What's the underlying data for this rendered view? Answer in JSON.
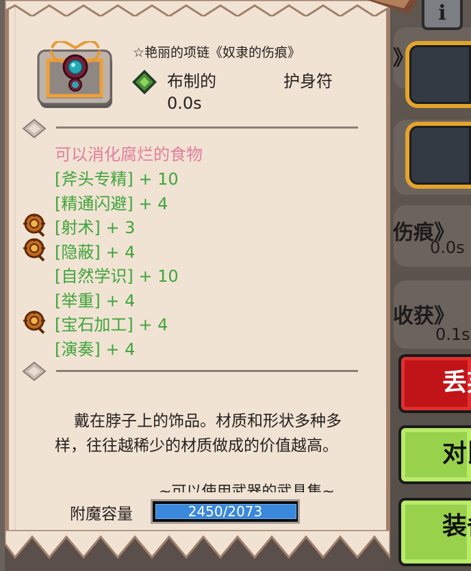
{
  "info_button": {
    "label": "i"
  },
  "item": {
    "name": "☆艳丽的项链《奴隶的伤痕》",
    "type": "布制的",
    "category": "护身符",
    "time": "0.0s"
  },
  "effects": {
    "special": "可以消化腐烂的食物",
    "stats": [
      {
        "label": "[斧头专精] + 10",
        "has_icon": false
      },
      {
        "label": "[精通闪避] + 4",
        "has_icon": false
      },
      {
        "label": "[射术] + 3",
        "has_icon": true
      },
      {
        "label": "[隐蔽] + 4",
        "has_icon": true
      },
      {
        "label": "[自然学识] + 10",
        "has_icon": false
      },
      {
        "label": "[举重] + 4",
        "has_icon": false
      },
      {
        "label": "[宝石加工] + 4",
        "has_icon": true
      },
      {
        "label": "[演奏] + 4",
        "has_icon": false
      }
    ]
  },
  "description": {
    "text": "戴在脖子上的饰品。材质和形状多种多样，往往越稀少的材质做成的价值越高。",
    "cut_line": "~可以使用武器的武具集~"
  },
  "enchant": {
    "label": "附魔容量",
    "value_text": "2450/2073",
    "current": 2450,
    "max": 2073
  },
  "background": {
    "card1_text": "》",
    "card2_title": "伤痕》",
    "card2_time": "0.0s",
    "card3_title": "收获》",
    "card3_time": "0.1s",
    "btn_red_label": "丢弃",
    "btn_green1_label": "对比",
    "btn_green2_label": "装备"
  },
  "colors": {
    "panel": "#f1e3d4",
    "stat_green": "#3ea43a",
    "special_pink": "#e07e9a",
    "slot_border": "#e4a42c",
    "enchant_fill": "#3a88dc"
  }
}
